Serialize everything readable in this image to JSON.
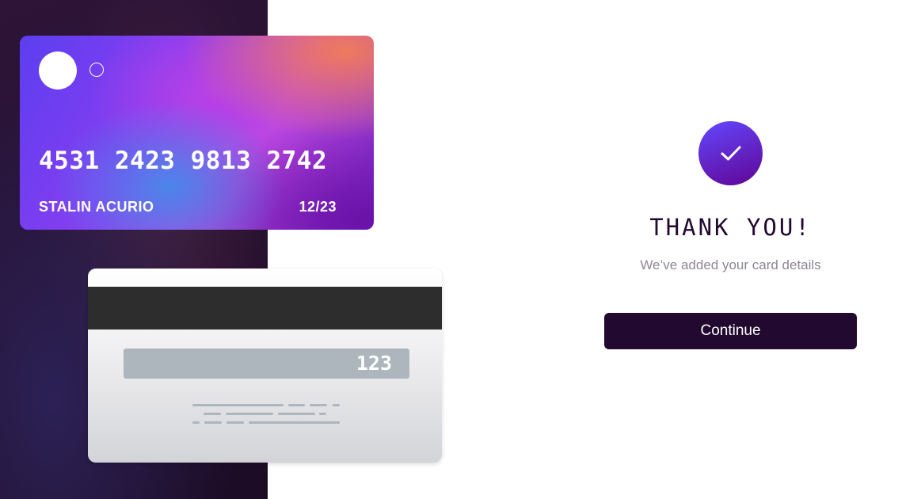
{
  "card_front": {
    "number": "4531 2423 9813 2742",
    "name": "STALIN ACURIO",
    "expiry": "12/23"
  },
  "card_back": {
    "cvc": "123"
  },
  "confirmation": {
    "icon": "checkmark-icon",
    "title": "THANK YOU!",
    "message": "We’ve added your card details",
    "button_label": "Continue"
  },
  "colors": {
    "accent_dark": "#21092f",
    "accent_gradient_start": "#6448fe",
    "accent_gradient_end": "#600594",
    "muted_text": "#8f8694"
  }
}
